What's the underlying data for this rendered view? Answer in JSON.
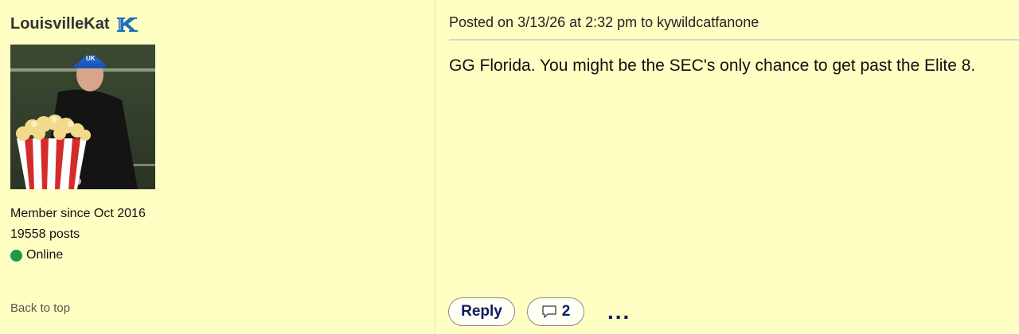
{
  "user": {
    "username": "LouisvilleKat",
    "member_since": "Member since Oct 2016",
    "posts": "19558 posts",
    "status": "Online"
  },
  "post": {
    "header": "Posted on 3/13/26 at 2:32 pm to kywildcatfanone",
    "body": "GG Florida. You might be the SEC's only chance to get past the Elite 8."
  },
  "actions": {
    "reply_label": "Reply",
    "comment_count": "2",
    "more_label": "..."
  },
  "nav": {
    "back_to_top": "Back to top"
  },
  "colors": {
    "background": "#ffffc3",
    "accent": "#0c1a5e",
    "online": "#1a9b4b",
    "team_logo": "#1b6fb8"
  },
  "icons": {
    "team_logo": "kentucky-k-logo-icon",
    "comment": "speech-bubble-icon",
    "online": "online-dot-icon"
  }
}
